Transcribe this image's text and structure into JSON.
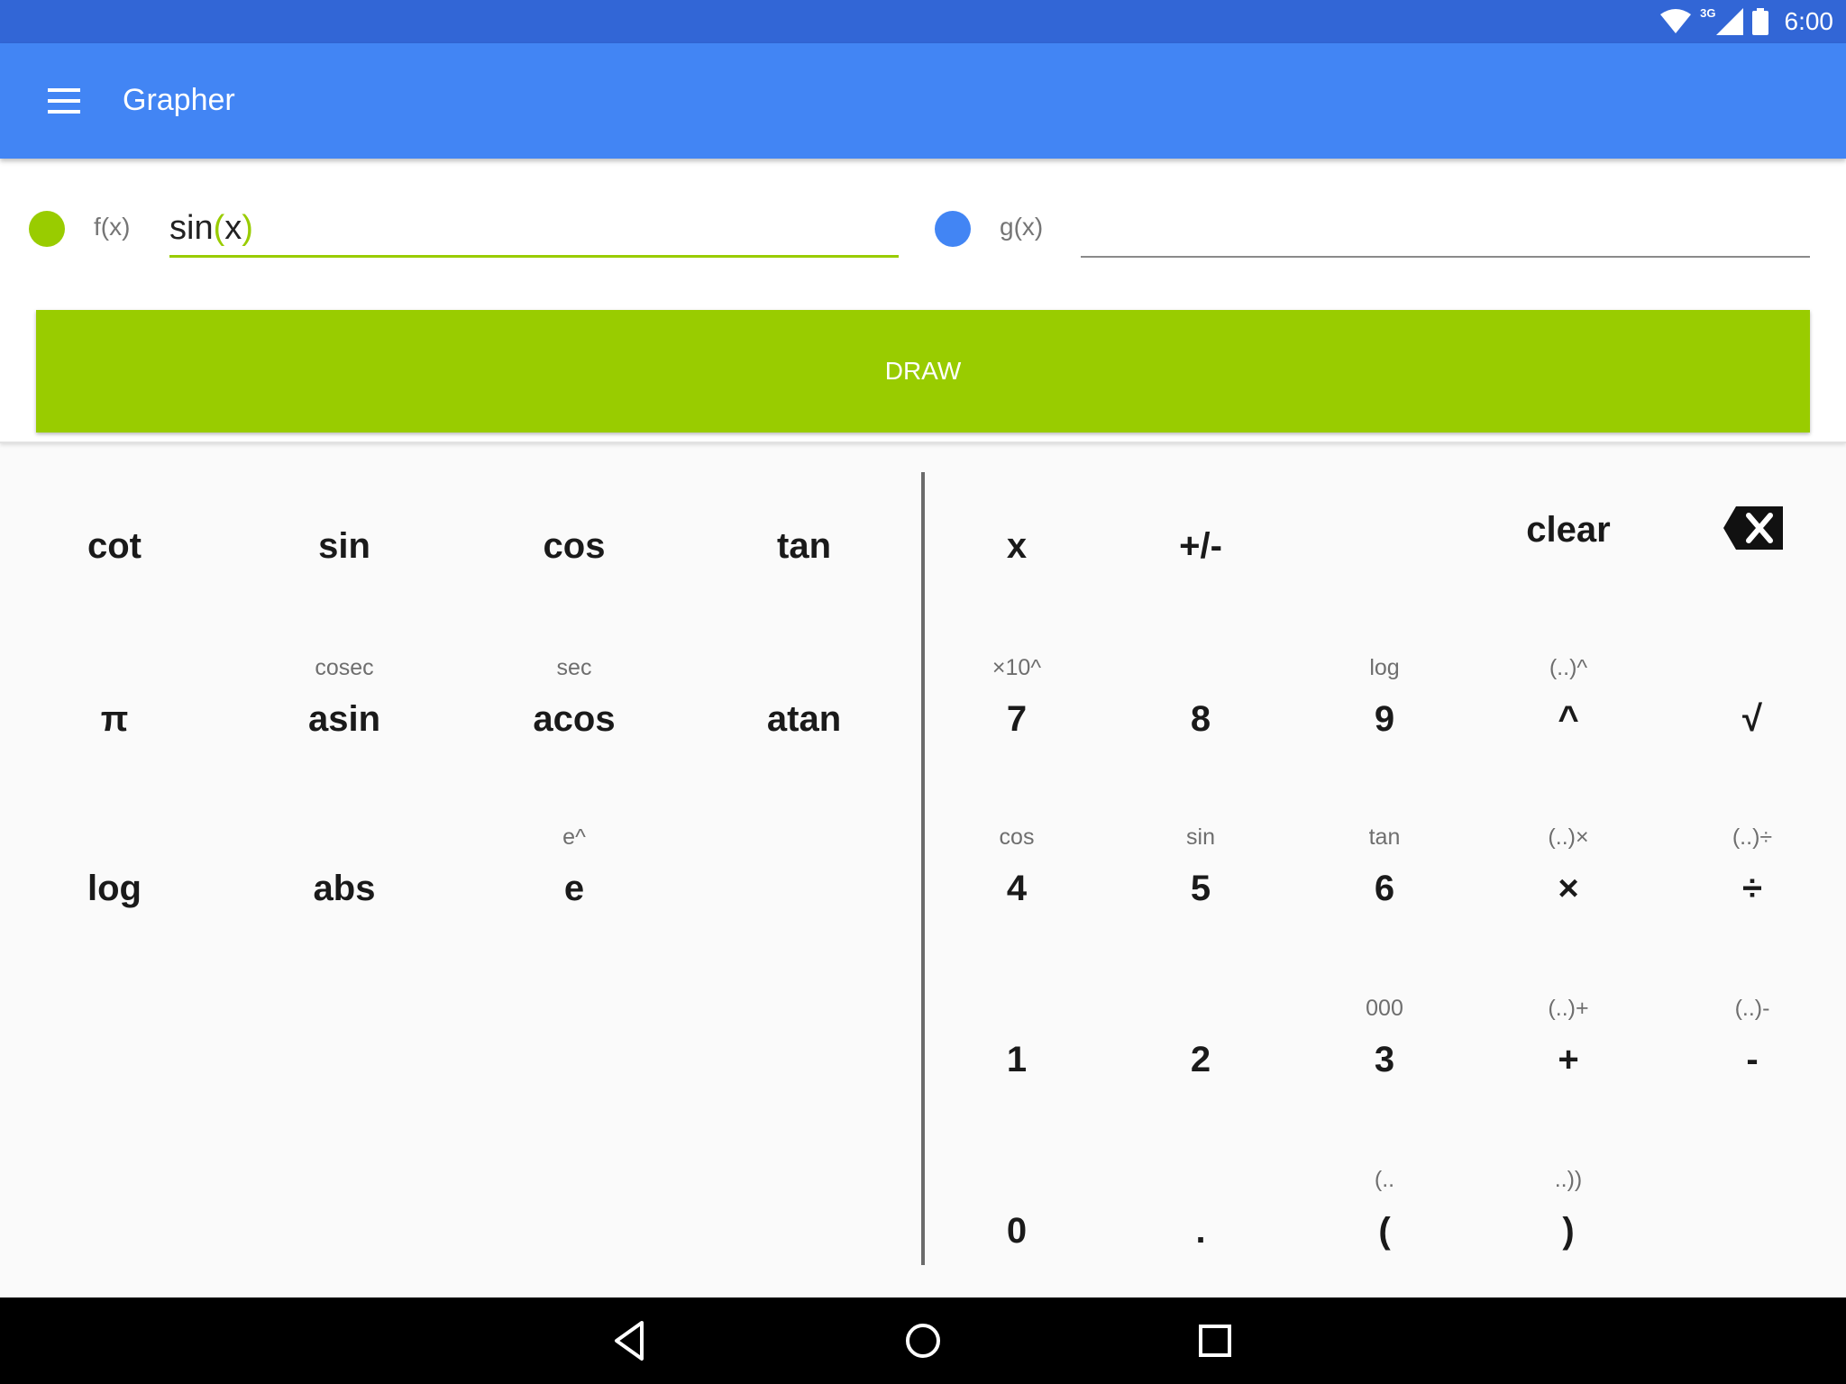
{
  "status_bar": {
    "time": "6:00",
    "network": "3G"
  },
  "app_bar": {
    "title": "Grapher"
  },
  "functions": {
    "f": {
      "label": "f(x)",
      "value_prefix": "sin",
      "value_open": "(",
      "value_var": "x",
      "value_close": ")",
      "color": "#99cc00"
    },
    "g": {
      "label": "g(x)",
      "value": "",
      "color": "#4285f4"
    }
  },
  "draw_button": {
    "label": "DRAW",
    "color": "#99cc00"
  },
  "keypad": {
    "left_keys": [
      {
        "main": "cot",
        "sub": ""
      },
      {
        "main": "sin",
        "sub": ""
      },
      {
        "main": "cos",
        "sub": ""
      },
      {
        "main": "tan",
        "sub": ""
      },
      {
        "main": "π",
        "sub": ""
      },
      {
        "main": "asin",
        "sub": "cosec"
      },
      {
        "main": "acos",
        "sub": "sec"
      },
      {
        "main": "atan",
        "sub": ""
      },
      {
        "main": "log",
        "sub": ""
      },
      {
        "main": "abs",
        "sub": ""
      },
      {
        "main": "e",
        "sub": "e^"
      }
    ],
    "right_keys": [
      {
        "main": "x",
        "sub": ""
      },
      {
        "main": "+/-",
        "sub": ""
      },
      {
        "main": "clear",
        "sub": ""
      },
      {
        "main": "7",
        "sub": "×10^"
      },
      {
        "main": "8",
        "sub": ""
      },
      {
        "main": "9",
        "sub": "log"
      },
      {
        "main": "^",
        "sub": "(..)^"
      },
      {
        "main": "√",
        "sub": ""
      },
      {
        "main": "4",
        "sub": "cos"
      },
      {
        "main": "5",
        "sub": "sin"
      },
      {
        "main": "6",
        "sub": "tan"
      },
      {
        "main": "×",
        "sub": "(..)×"
      },
      {
        "main": "÷",
        "sub": "(..)÷"
      },
      {
        "main": "1",
        "sub": ""
      },
      {
        "main": "2",
        "sub": ""
      },
      {
        "main": "3",
        "sub": "000"
      },
      {
        "main": "+",
        "sub": "(..)+"
      },
      {
        "main": "-",
        "sub": "(..)-"
      },
      {
        "main": "0",
        "sub": ""
      },
      {
        "main": ".",
        "sub": ""
      },
      {
        "main": "(",
        "sub": "(.."
      },
      {
        "main": ")",
        "sub": "..))"
      }
    ]
  }
}
